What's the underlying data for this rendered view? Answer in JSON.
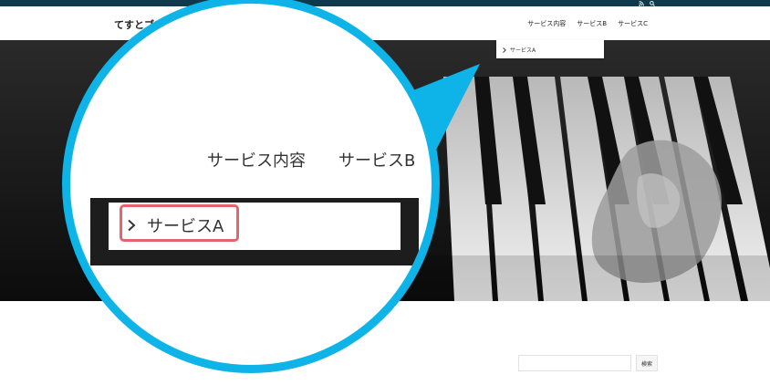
{
  "site": {
    "title": "てすとブログ"
  },
  "topbar": {
    "icons": [
      "rss-icon",
      "search-icon"
    ],
    "color": "#0f3a4c"
  },
  "nav": {
    "items": [
      {
        "label": "サービス内容",
        "active": true
      },
      {
        "label": "サービスB"
      },
      {
        "label": "サービスC"
      }
    ]
  },
  "dropdown": {
    "items": [
      {
        "label": "サービスA"
      }
    ]
  },
  "sidebar": {
    "search_button": "検索",
    "search_value": ""
  },
  "callout": {
    "nav": [
      "サービス内容",
      "サービスB"
    ],
    "highlighted_item": "サービスA",
    "accent_color": "#0eb4e8",
    "highlight_color": "#e6646c"
  }
}
